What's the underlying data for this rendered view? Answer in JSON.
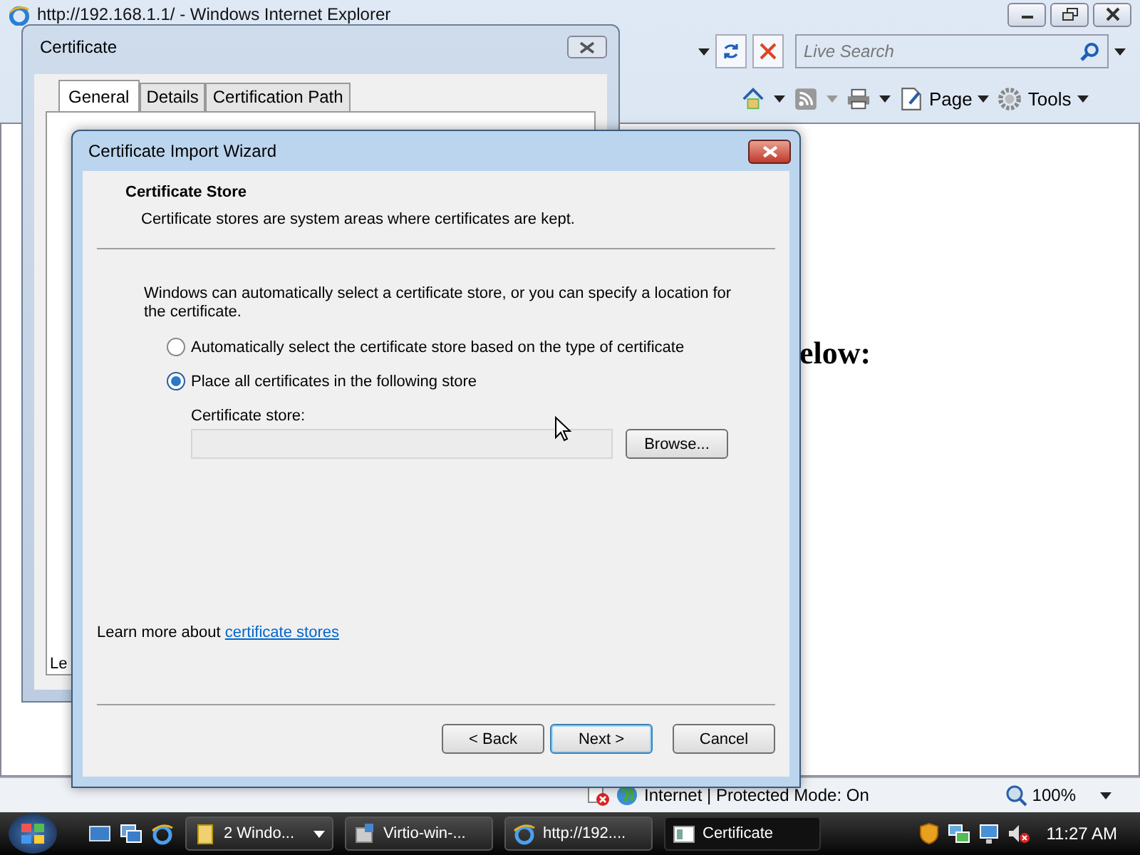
{
  "browser": {
    "title": "http://192.168.1.1/ - Windows Internet Explorer",
    "search": {
      "placeholder": "Live Search"
    },
    "commands": [
      {
        "label": "Page",
        "kind": "page"
      },
      {
        "label": "Tools",
        "kind": "tools"
      }
    ],
    "page_text": "elow:",
    "status": {
      "zone": "Internet | Protected Mode: On",
      "zoom": "100%"
    }
  },
  "certificate_dialog": {
    "title": "Certificate",
    "tabs": [
      {
        "label": "General",
        "selected": true
      },
      {
        "label": "Details",
        "selected": false
      },
      {
        "label": "Certification Path",
        "selected": false
      }
    ],
    "fragment": "Le"
  },
  "wizard": {
    "title": "Certificate Import Wizard",
    "heading": "Certificate Store",
    "subheading": "Certificate stores are system areas where certificates are kept.",
    "intro": "Windows can automatically select a certificate store, or you can specify a location for the certificate.",
    "options": [
      {
        "label": "Automatically select the certificate store based on the type of certificate",
        "selected": false
      },
      {
        "label": "Place all certificates in the following store",
        "selected": true
      }
    ],
    "store_label": "Certificate store:",
    "browse": "Browse...",
    "learn_more": "Learn more about ",
    "link": "certificate stores",
    "buttons": [
      {
        "label": "< Back",
        "kind": "normal"
      },
      {
        "label": "Next >",
        "kind": "default"
      },
      {
        "label": "Cancel",
        "kind": "normal"
      }
    ]
  },
  "taskbar": {
    "items": [
      {
        "label": "2 Windo...",
        "selected": false,
        "kind": "folder"
      },
      {
        "label": "Virtio-win-...",
        "selected": false,
        "kind": "installer"
      },
      {
        "label": "http://192....",
        "selected": false,
        "kind": "browser"
      },
      {
        "label": "Certificate",
        "selected": true,
        "kind": "window"
      }
    ],
    "clock": "11:27 AM"
  }
}
